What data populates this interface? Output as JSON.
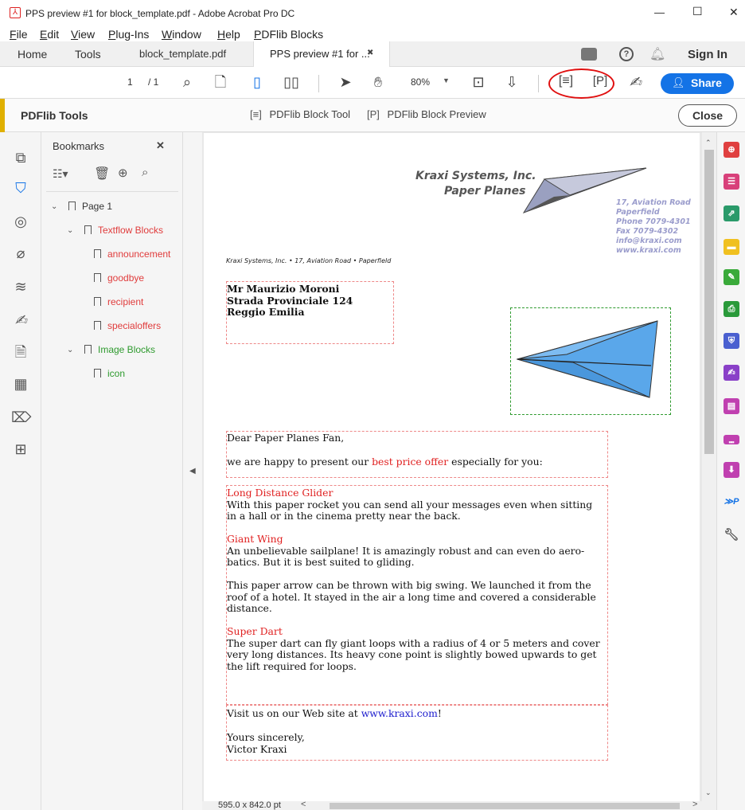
{
  "window": {
    "title": "PPS preview #1 for block_template.pdf - Adobe Acrobat Pro DC",
    "minimize": "—",
    "maximize": "☐",
    "close": "✕"
  },
  "menu": [
    "File",
    "Edit",
    "View",
    "Plug-Ins",
    "Window",
    "Help",
    "PDFlib Blocks"
  ],
  "tabs": {
    "home": "Home",
    "tools": "Tools",
    "doc1": "block_template.pdf",
    "doc2": "PPS preview #1 for ...",
    "doc2_close": "✖",
    "sign_in": "Sign In"
  },
  "toolbar": {
    "page_current": "1",
    "page_total": "/ 1",
    "zoom": "80%",
    "share": "Share"
  },
  "secbar": {
    "title": "PDFlib Tools",
    "block_tool": "PDFlib Block Tool",
    "block_preview": "PDFlib Block Preview",
    "close": "Close"
  },
  "bookmarks": {
    "title": "Bookmarks",
    "close": "✕",
    "items": [
      {
        "label": "Page 1",
        "color": "#333333"
      },
      {
        "label": "Textflow Blocks",
        "color": "#e03c3c"
      },
      {
        "label": "announcement",
        "color": "#e03c3c"
      },
      {
        "label": "goodbye",
        "color": "#e03c3c"
      },
      {
        "label": "recipient",
        "color": "#e03c3c"
      },
      {
        "label": "specialoffers",
        "color": "#e03c3c"
      },
      {
        "label": "Image Blocks",
        "color": "#2e9a2e"
      },
      {
        "label": "icon",
        "color": "#2e9a2e"
      }
    ]
  },
  "doc": {
    "company": "Kraxi Systems, Inc.",
    "product": "Paper Planes",
    "addr_lines": [
      "17, Aviation Road",
      "Paperfield",
      "Phone 7079-4301",
      "Fax 7079-4302",
      "info@kraxi.com",
      "www.kraxi.com"
    ],
    "sender_line": "Kraxi Systems, Inc. • 17, Aviation Road • Paperfield",
    "recipient": [
      "Mr Maurizio Moroni",
      "Strada Provinciale 124",
      "Reggio Emilia"
    ],
    "greeting": "Dear Paper Planes Fan,",
    "intro_a": "we are happy to present our ",
    "intro_offer": "best price offer",
    "intro_b": " especially for you:",
    "offers": [
      {
        "title": "Long Distance Glider",
        "lines": [
          "With this paper rocket you can send all your messages even when sitting",
          "in a hall or in the cinema pretty near the back."
        ]
      },
      {
        "title": "Giant Wing",
        "lines": [
          "An unbelievable sailplane! It is amazingly robust and can even do aero-",
          "batics. But it is best suited to gliding."
        ]
      },
      {
        "title": "",
        "lines": [
          "This paper arrow can be thrown with big swing. We launched it from the",
          "roof of a hotel. It stayed in the air a long time and covered a considerable",
          "distance."
        ]
      },
      {
        "title": "Super Dart",
        "lines": [
          "The super dart can fly giant loops with a radius of 4 or 5 meters and cover",
          "very long distances. Its heavy cone point is slightly bowed upwards to get",
          "the lift required for loops."
        ]
      }
    ],
    "visit_a": "Visit us on our Web site at ",
    "visit_link": "www.kraxi.com",
    "visit_b": "!",
    "closing": "Yours sincerely,",
    "signature": "Victor Kraxi"
  },
  "status": {
    "page_size": "595.0 x 842.0 pt",
    "scroll_left": "<",
    "scroll_right": ">"
  },
  "colors": {
    "accent_blue": "#1473e6",
    "textflow_red": "#e03c3c",
    "image_green": "#2e9a2e",
    "highlight_circle": "#e01010"
  }
}
